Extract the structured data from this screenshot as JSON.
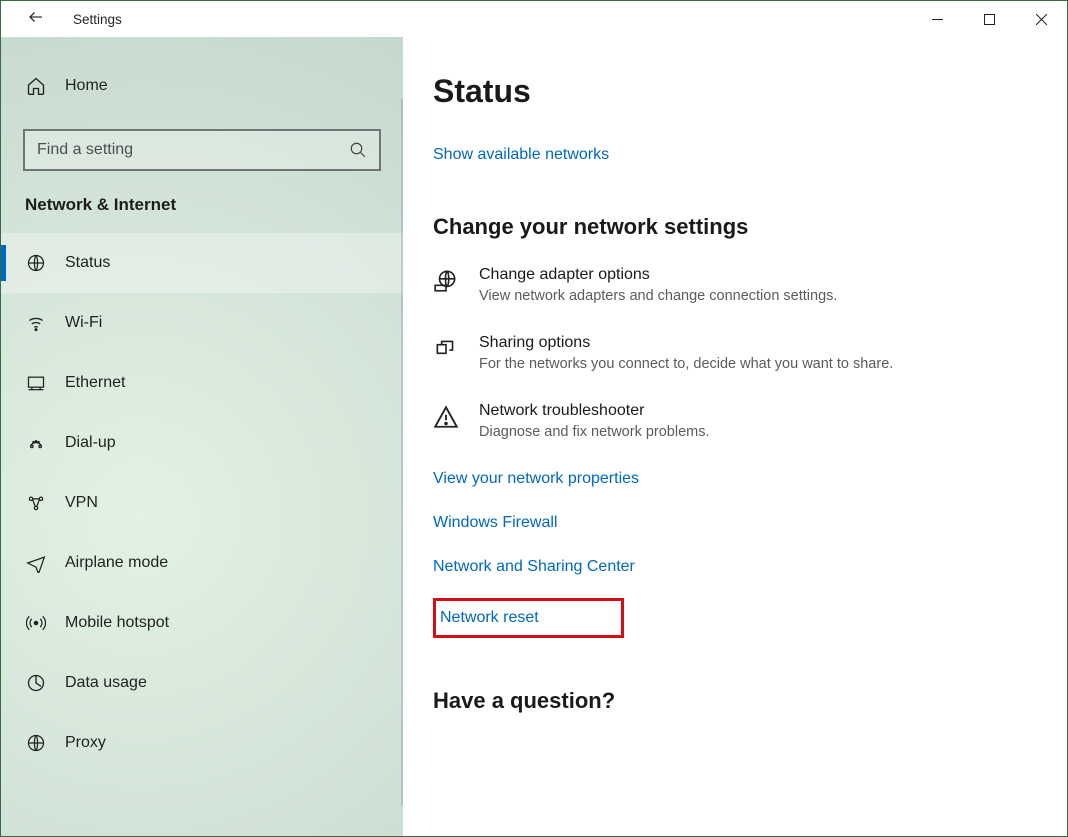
{
  "window": {
    "title": "Settings"
  },
  "sidebar": {
    "home_label": "Home",
    "search_placeholder": "Find a setting",
    "category_label": "Network & Internet",
    "items": [
      {
        "label": "Status"
      },
      {
        "label": "Wi-Fi"
      },
      {
        "label": "Ethernet"
      },
      {
        "label": "Dial-up"
      },
      {
        "label": "VPN"
      },
      {
        "label": "Airplane mode"
      },
      {
        "label": "Mobile hotspot"
      },
      {
        "label": "Data usage"
      },
      {
        "label": "Proxy"
      }
    ]
  },
  "content": {
    "page_title": "Status",
    "show_networks_link": "Show available networks",
    "change_settings_heading": "Change your network settings",
    "options": [
      {
        "title": "Change adapter options",
        "desc": "View network adapters and change connection settings."
      },
      {
        "title": "Sharing options",
        "desc": "For the networks you connect to, decide what you want to share."
      },
      {
        "title": "Network troubleshooter",
        "desc": "Diagnose and fix network problems."
      }
    ],
    "links": {
      "view_properties": "View your network properties",
      "firewall": "Windows Firewall",
      "sharing_center": "Network and Sharing Center",
      "network_reset": "Network reset"
    },
    "question_heading": "Have a question?"
  }
}
